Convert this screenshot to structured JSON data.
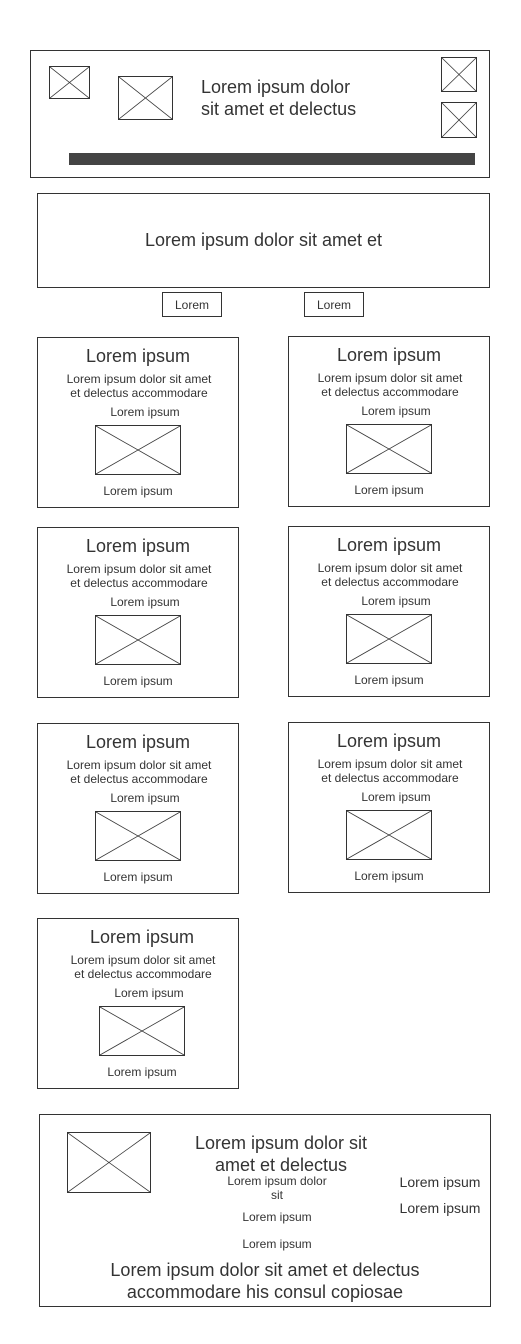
{
  "header": {
    "title_line1": "Lorem ipsum dolor",
    "title_line2": "sit amet et delectus",
    "bar_color": "#444444"
  },
  "banner": {
    "text": "Lorem ipsum dolor sit amet et"
  },
  "buttons": {
    "left_label": "Lorem",
    "right_label": "Lorem"
  },
  "cards": [
    {
      "title": "Lorem ipsum",
      "desc_line1": "Lorem ipsum dolor sit amet",
      "desc_line2": "et delectus accommodare",
      "subtitle": "Lorem ipsum",
      "footer": "Lorem ipsum"
    },
    {
      "title": "Lorem ipsum",
      "desc_line1": "Lorem ipsum dolor sit amet",
      "desc_line2": "et delectus accommodare",
      "subtitle": "Lorem ipsum",
      "footer": "Lorem ipsum"
    },
    {
      "title": "Lorem ipsum",
      "desc_line1": "Lorem ipsum dolor sit amet",
      "desc_line2": "et delectus accommodare",
      "subtitle": "Lorem ipsum",
      "footer": "Lorem ipsum"
    },
    {
      "title": "Lorem ipsum",
      "desc_line1": "Lorem ipsum dolor sit amet",
      "desc_line2": "et delectus accommodare",
      "subtitle": "Lorem ipsum",
      "footer": "Lorem ipsum"
    },
    {
      "title": "Lorem ipsum",
      "desc_line1": "Lorem ipsum dolor sit amet",
      "desc_line2": "et delectus accommodare",
      "subtitle": "Lorem ipsum",
      "footer": "Lorem ipsum"
    },
    {
      "title": "Lorem ipsum",
      "desc_line1": "Lorem ipsum dolor sit amet",
      "desc_line2": "et delectus accommodare",
      "subtitle": "Lorem ipsum",
      "footer": "Lorem ipsum"
    },
    {
      "title": "Lorem ipsum",
      "desc_line1": "Lorem ipsum dolor sit amet",
      "desc_line2": "et delectus accommodare",
      "subtitle": "Lorem ipsum",
      "footer": "Lorem ipsum"
    }
  ],
  "footer": {
    "title_line1": "Lorem ipsum dolor sit",
    "title_line2": "amet et delectus",
    "sub_line1": "Lorem ipsum dolor",
    "sub_line2": "sit",
    "link1": "Lorem ipsum",
    "link2": "Lorem ipsum",
    "side_link1": "Lorem ipsum",
    "side_link2": "Lorem ipsum",
    "bottom_line1": "Lorem ipsum dolor sit amet et delectus",
    "bottom_line2": "accommodare his consul copiosae"
  },
  "icons": {
    "placeholder": "image-placeholder-icon"
  }
}
